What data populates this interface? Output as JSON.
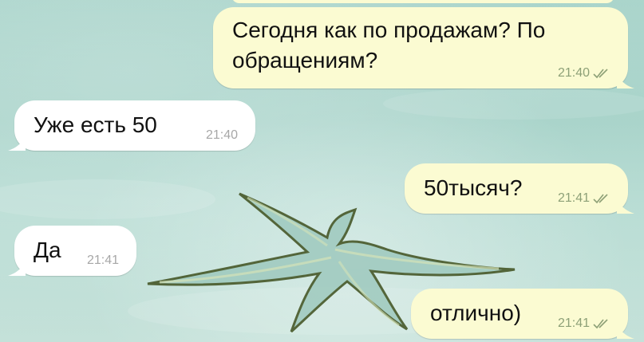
{
  "chat": {
    "messages": [
      {
        "direction": "out",
        "text": "Сегодня как по продажам? По обращениям?",
        "time": "21:40",
        "status": "read-double-check-icon"
      },
      {
        "direction": "in",
        "text": "Уже есть 50",
        "time": "21:40"
      },
      {
        "direction": "out",
        "text": "50тысяч?",
        "time": "21:41",
        "status": "read-double-check-icon"
      },
      {
        "direction": "in",
        "text": "Да",
        "time": "21:41"
      },
      {
        "direction": "out",
        "text": "отлично)",
        "time": "21:41",
        "status": "read-double-check-icon"
      }
    ]
  },
  "colors": {
    "incoming_bubble": "#ffffff",
    "outgoing_bubble": "#fbfbd2",
    "outgoing_meta": "#8da077",
    "incoming_meta": "#a7a7a7",
    "wallpaper": "#b9ddd4"
  },
  "icons": {
    "read_status": "double-check-icon",
    "wallpaper": "starfish-on-sand-image"
  }
}
